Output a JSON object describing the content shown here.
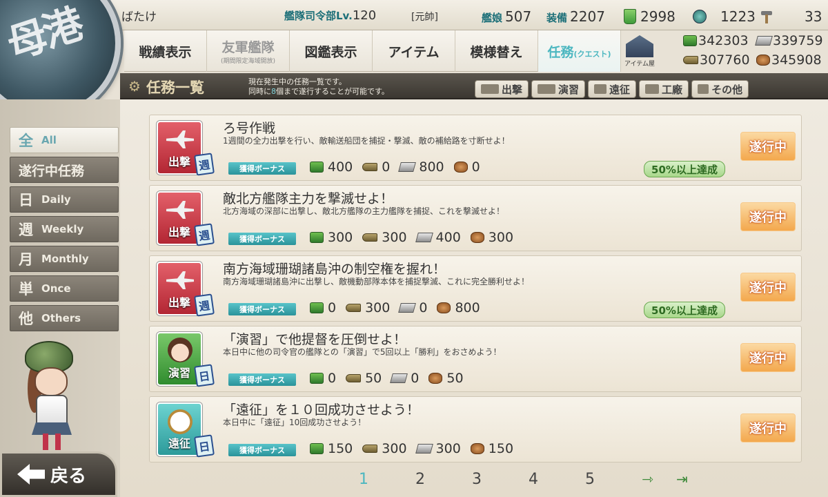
{
  "header": {
    "admiral_name": "ばたけ",
    "hq_label": "艦隊司令部Lv.",
    "hq_level": "120",
    "rank": "[元帥]",
    "ships_label": "艦娘",
    "ships_count": "507",
    "equip_label": "装備",
    "equip_count": "2207",
    "buckets": "2998",
    "screws": "1223",
    "hammers": "33"
  },
  "nav": {
    "items": [
      {
        "label": "戦績表示"
      },
      {
        "label": "友軍艦隊",
        "sub": "(期間限定海域開放)"
      },
      {
        "label": "図鑑表示"
      },
      {
        "label": "アイテム"
      },
      {
        "label": "模様替え"
      },
      {
        "label": "任務",
        "en": "(クエスト)"
      }
    ],
    "item_shop_label": "アイテム屋"
  },
  "resources": {
    "fuel": "342303",
    "ammo": "307760",
    "steel": "339759",
    "bauxite": "345908"
  },
  "emblem": {
    "text": "母港"
  },
  "title": {
    "text": "任務一覧",
    "desc_line1": "現在発生中の任務一覧です。",
    "desc_line2_pre": "同時に",
    "desc_line2_hl": "8",
    "desc_line2_post": "個まで遂行することが可能です。"
  },
  "filter_tabs": [
    {
      "label": "出撃"
    },
    {
      "label": "演習"
    },
    {
      "label": "遠征"
    },
    {
      "label": "工廠"
    },
    {
      "label": "その他"
    }
  ],
  "left_menu": [
    {
      "kanji": "全",
      "en": "All"
    },
    {
      "kanji": "遂行中任務",
      "en": ""
    },
    {
      "kanji": "日",
      "en": "Daily"
    },
    {
      "kanji": "週",
      "en": "Weekly"
    },
    {
      "kanji": "月",
      "en": "Monthly"
    },
    {
      "kanji": "単",
      "en": "Once"
    },
    {
      "kanji": "他",
      "en": "Others"
    }
  ],
  "back_label": "戻る",
  "bonus_label": "獲得ボーナス",
  "state_label": "遂行中",
  "quests": [
    {
      "category": "出撃",
      "type": "週",
      "title": "ろ号作戦",
      "desc": "1週間の全力出撃を行い、敵輸送船団を捕捉・撃滅、敵の補給路を寸断せよ！",
      "fuel": "400",
      "ammo": "0",
      "steel": "800",
      "bauxite": "0",
      "progress": "50%以上達成"
    },
    {
      "category": "出撃",
      "type": "週",
      "title": "敵北方艦隊主力を撃滅せよ！",
      "desc": "北方海域の深部に出撃し、敵北方艦隊の主力艦隊を捕捉、これを撃滅せよ！",
      "fuel": "300",
      "ammo": "300",
      "steel": "400",
      "bauxite": "300",
      "progress": ""
    },
    {
      "category": "出撃",
      "type": "週",
      "title": "南方海域珊瑚諸島沖の制空権を握れ！",
      "desc": "南方海域珊瑚諸島沖に出撃し、敵機動部隊本体を捕捉撃滅、これに完全勝利せよ！",
      "fuel": "0",
      "ammo": "300",
      "steel": "0",
      "bauxite": "800",
      "progress": "50%以上達成"
    },
    {
      "category": "演習",
      "type": "日",
      "title": "「演習」で他提督を圧倒せよ！",
      "desc": "本日中に他の司令官の艦隊との「演習」で5回以上「勝利」をおさめよう！",
      "fuel": "0",
      "ammo": "50",
      "steel": "0",
      "bauxite": "50",
      "progress": ""
    },
    {
      "category": "遠征",
      "type": "日",
      "title": "「遠征」を１０回成功させよう！",
      "desc": "本日中に「遠征」10回成功させよう！",
      "fuel": "150",
      "ammo": "300",
      "steel": "300",
      "bauxite": "150",
      "progress": ""
    }
  ],
  "pager": {
    "pages": [
      "1",
      "2",
      "3",
      "4",
      "5"
    ],
    "current": "1",
    "next_icon": "next-page-icon",
    "last_icon": "last-page-icon"
  }
}
